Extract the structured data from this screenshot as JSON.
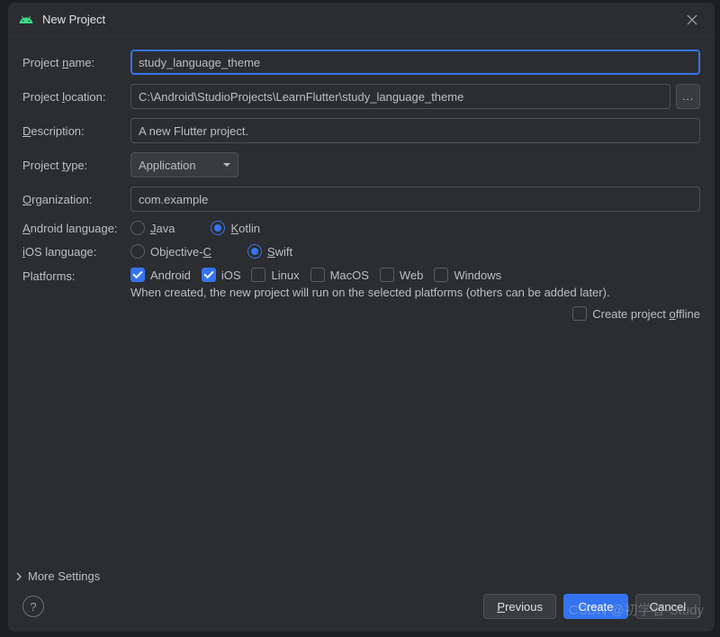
{
  "titlebar": {
    "title": "New Project"
  },
  "form": {
    "project_name": {
      "label_pre": "Project ",
      "label_ul": "n",
      "label_post": "ame:",
      "value": "study_language_theme"
    },
    "project_location": {
      "label_pre": "Project ",
      "label_ul": "l",
      "label_post": "ocation:",
      "value": "C:\\Android\\StudioProjects\\LearnFlutter\\study_language_theme",
      "browse": "..."
    },
    "description": {
      "label_ul": "D",
      "label_post": "escription:",
      "value": "A new Flutter project."
    },
    "project_type": {
      "label_pre": "Project ",
      "label_ul": "t",
      "label_post": "ype:",
      "selected": "Application"
    },
    "organization": {
      "label_ul": "O",
      "label_post": "rganization:",
      "value": "com.example"
    },
    "android_lang": {
      "label_ul": "A",
      "label_post": "ndroid language:",
      "options": [
        {
          "ul": "J",
          "post": "ava",
          "checked": false
        },
        {
          "ul": "K",
          "post": "otlin",
          "checked": true
        }
      ]
    },
    "ios_lang": {
      "label_ul": "i",
      "label_post": "OS language:",
      "options": [
        {
          "pre": "Objective-",
          "ul": "C",
          "checked": false
        },
        {
          "ul": "S",
          "post": "wift",
          "checked": true
        }
      ]
    },
    "platforms": {
      "label": "Platforms:",
      "items": [
        {
          "label": "Android",
          "checked": true
        },
        {
          "label": "iOS",
          "checked": true
        },
        {
          "label": "Linux",
          "checked": false
        },
        {
          "label": "MacOS",
          "checked": false
        },
        {
          "label": "Web",
          "checked": false
        },
        {
          "label": "Windows",
          "checked": false
        }
      ],
      "note": "When created, the new project will run on the selected platforms (others can be added later)."
    },
    "offline": {
      "label_pre": "Create project ",
      "label_ul": "o",
      "label_post": "ffline",
      "checked": false
    }
  },
  "more_settings": "More Settings",
  "footer": {
    "previous": {
      "ul": "P",
      "post": "revious"
    },
    "create": "Create",
    "cancel": "Cancel"
  },
  "watermark": "CSDN @初学者-Study"
}
